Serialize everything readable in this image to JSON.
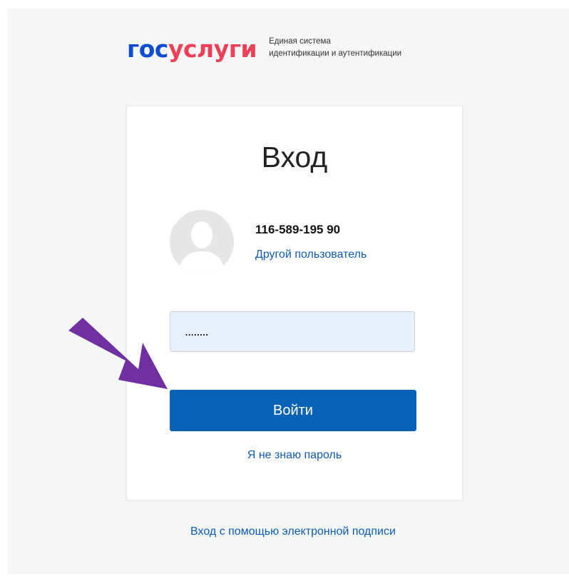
{
  "header": {
    "logo_part1": "гос",
    "logo_part2": "услуги",
    "tagline_line1": "Единая система",
    "tagline_line2": "идентификации и аутентификации"
  },
  "card": {
    "title": "Вход",
    "user_id": "116-589-195 90",
    "other_user_link": "Другой пользователь",
    "password_value": "........",
    "login_button": "Войти",
    "forgot_password_link": "Я не знаю пароль"
  },
  "footer": {
    "signature_login_link": "Вход с помощью электронной подписи"
  },
  "colors": {
    "logo_blue": "#0d4cd3",
    "logo_red": "#ee3f58",
    "primary_button": "#0963b4",
    "link": "#0d5bb5",
    "annotation_arrow": "#7030a0"
  },
  "icons": {
    "avatar": "user-silhouette-icon",
    "annotation": "arrow-pointer-icon"
  }
}
